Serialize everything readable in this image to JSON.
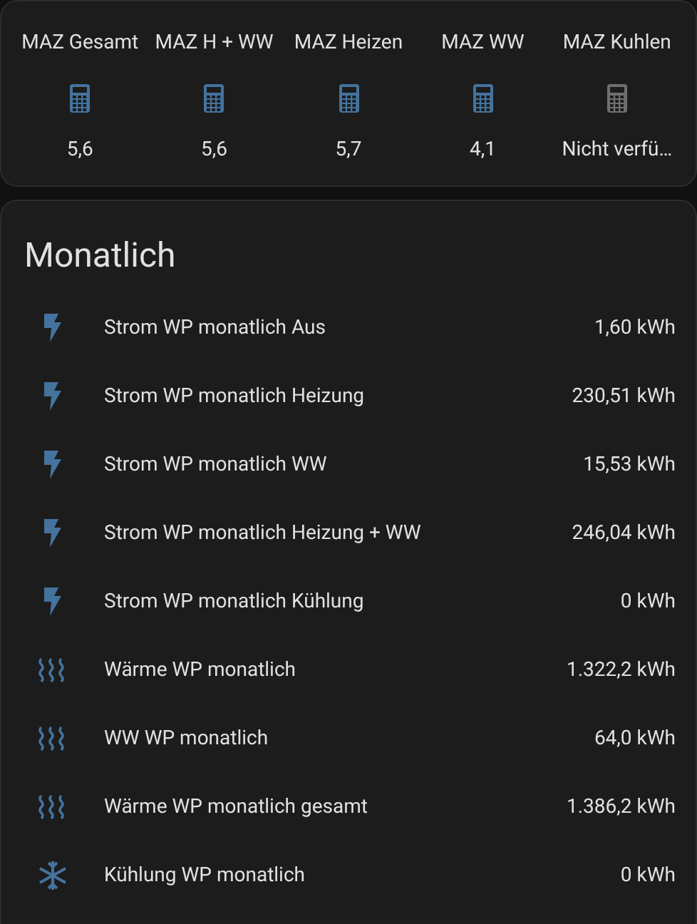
{
  "glance": [
    {
      "name": "MAZ Gesamt",
      "value": "5,6",
      "available": true
    },
    {
      "name": "MAZ H + WW",
      "value": "5,6",
      "available": true
    },
    {
      "name": "MAZ Heizen",
      "value": "5,7",
      "available": true
    },
    {
      "name": "MAZ WW",
      "value": "4,1",
      "available": true
    },
    {
      "name": "MAZ Kuhlen",
      "value": "Nicht verfü…",
      "available": false
    }
  ],
  "monthly": {
    "title": "Monatlich",
    "rows": [
      {
        "kind": "power",
        "name": "Strom WP monatlich Aus",
        "value": "1,60 kWh"
      },
      {
        "kind": "power",
        "name": "Strom WP monatlich Heizung",
        "value": "230,51 kWh"
      },
      {
        "kind": "power",
        "name": "Strom WP monatlich WW",
        "value": "15,53 kWh"
      },
      {
        "kind": "power",
        "name": "Strom WP monatlich Heizung + WW",
        "value": "246,04 kWh"
      },
      {
        "kind": "power",
        "name": "Strom WP monatlich Kühlung",
        "value": "0 kWh"
      },
      {
        "kind": "heat",
        "name": "Wärme WP monatlich",
        "value": "1.322,2 kWh"
      },
      {
        "kind": "heat",
        "name": "WW WP monatlich",
        "value": "64,0 kWh"
      },
      {
        "kind": "heat",
        "name": "Wärme WP monatlich gesamt",
        "value": "1.386,2 kWh"
      },
      {
        "kind": "cool",
        "name": "Kühlung WP monatlich",
        "value": "0 kWh"
      }
    ]
  }
}
